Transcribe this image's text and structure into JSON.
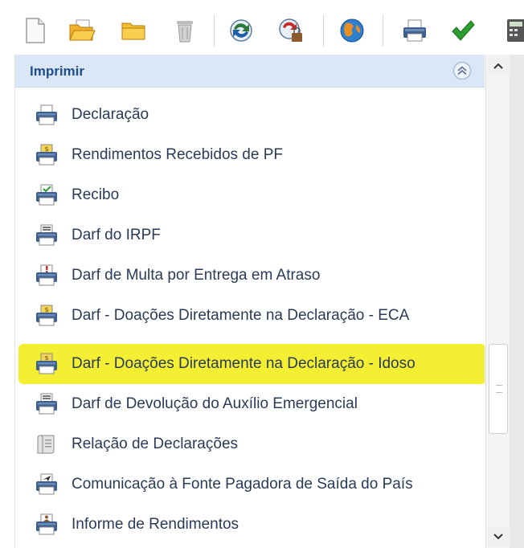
{
  "panel": {
    "title": "Imprimir"
  },
  "toolbar": {
    "buttons": [
      {
        "icon": "new-document-icon"
      },
      {
        "icon": "open-folder-icon"
      },
      {
        "icon": "folder-icon"
      },
      {
        "icon": "trash-icon"
      },
      {
        "icon": "transmit-icon"
      },
      {
        "icon": "receipt-lock-icon"
      },
      {
        "icon": "globe-icon"
      },
      {
        "icon": "printer-icon"
      },
      {
        "icon": "check-icon"
      },
      {
        "icon": "calculator-icon"
      }
    ]
  },
  "items": [
    {
      "label": "Declaração"
    },
    {
      "label": "Rendimentos Recebidos de PF"
    },
    {
      "label": "Recibo"
    },
    {
      "label": "Darf do IRPF"
    },
    {
      "label": "Darf de Multa por Entrega em Atraso"
    },
    {
      "label": "Darf - Doações Diretamente na Declaração - ECA"
    },
    {
      "label": "Darf - Doações Diretamente na Declaração - Idoso"
    },
    {
      "label": "Darf de Devolução do Auxílio Emergencial"
    },
    {
      "label": "Relação de Declarações"
    },
    {
      "label": "Comunicação à Fonte Pagadora de Saída do País"
    },
    {
      "label": "Informe de Rendimentos"
    }
  ],
  "highlight_color": "#f3ee28",
  "accent_color": "#1f4f8b"
}
